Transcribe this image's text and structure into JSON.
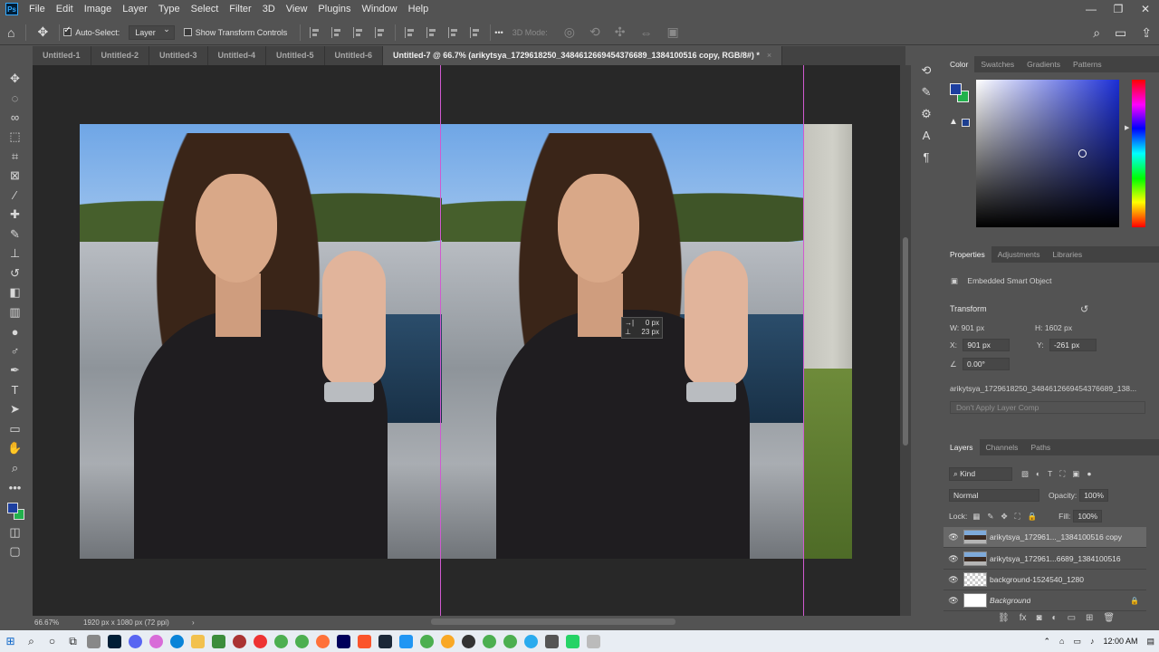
{
  "app": {
    "name": "Adobe Photoshop",
    "logo": "Ps"
  },
  "menu": [
    "File",
    "Edit",
    "Image",
    "Layer",
    "Type",
    "Select",
    "Filter",
    "3D",
    "View",
    "Plugins",
    "Window",
    "Help"
  ],
  "window_controls": {
    "minimize": "—",
    "restore": "❐",
    "close": "✕"
  },
  "options_bar": {
    "auto_select_label": "Auto-Select:",
    "auto_select_checked": true,
    "auto_select_target": "Layer",
    "transform_controls_label": "Show Transform Controls",
    "transform_controls_checked": false,
    "mode_3d_label": "3D Mode:",
    "more_label": "•••"
  },
  "tabs": [
    {
      "label": "Untitled-1",
      "active": false
    },
    {
      "label": "Untitled-2",
      "active": false
    },
    {
      "label": "Untitled-3",
      "active": false
    },
    {
      "label": "Untitled-4",
      "active": false
    },
    {
      "label": "Untitled-5",
      "active": false
    },
    {
      "label": "Untitled-6",
      "active": false
    },
    {
      "label": "Untitled-7 @ 66.7% (arikytsya_1729618250_3484612669454376689_1384100516 copy, RGB/8#) *",
      "active": true
    }
  ],
  "tab_close": "×",
  "canvas": {
    "tooltip_x": "0 px",
    "tooltip_y": "23 px",
    "tooltip_x_icon": "→|",
    "tooltip_y_icon": "⊥"
  },
  "status": {
    "zoom": "66.67%",
    "doc_info": "1920 px x 1080 px (72 ppi)",
    "arrow": "›"
  },
  "color_panel": {
    "tabs": [
      "Color",
      "Swatches",
      "Gradients",
      "Patterns"
    ],
    "active_tab": "Color",
    "foreground": "#1d3fa0",
    "background": "#22b14c",
    "warning_icon": "▲"
  },
  "properties_panel": {
    "tabs": [
      "Properties",
      "Adjustments",
      "Libraries"
    ],
    "active_tab": "Properties",
    "object_type": "Embedded Smart Object",
    "transform_label": "Transform",
    "w_label": "W:",
    "w_value": "901 px",
    "h_label": "H:",
    "h_value": "1602 px",
    "x_label": "X:",
    "x_value": "901 px",
    "y_label": "Y:",
    "y_value": "-261 px",
    "angle_value": "0.00°",
    "file_name": "arikytsya_1729618250_3484612669454376689_138...",
    "layer_comp": "Don't Apply Layer Comp"
  },
  "layers_panel": {
    "tabs": [
      "Layers",
      "Channels",
      "Paths"
    ],
    "active_tab": "Layers",
    "filter_kind": "Kind",
    "blend_mode": "Normal",
    "opacity_label": "Opacity:",
    "opacity_value": "100%",
    "lock_label": "Lock:",
    "fill_label": "Fill:",
    "fill_value": "100%",
    "layers": [
      {
        "name": "arikytsya_172961..._1384100516 copy",
        "selected": true,
        "thumb": "img"
      },
      {
        "name": "arikytsya_172961...6689_1384100516",
        "selected": false,
        "thumb": "img"
      },
      {
        "name": "background-1524540_1280",
        "selected": false,
        "thumb": "checker"
      },
      {
        "name": "Background",
        "selected": false,
        "thumb": "white",
        "locked": true
      }
    ],
    "bottom_icons": [
      "link-icon",
      "fx-icon",
      "mask-icon",
      "adjustment-icon",
      "group-icon",
      "new-layer-icon",
      "trash-icon"
    ]
  },
  "taskbar": {
    "time": "12:00 AM"
  }
}
